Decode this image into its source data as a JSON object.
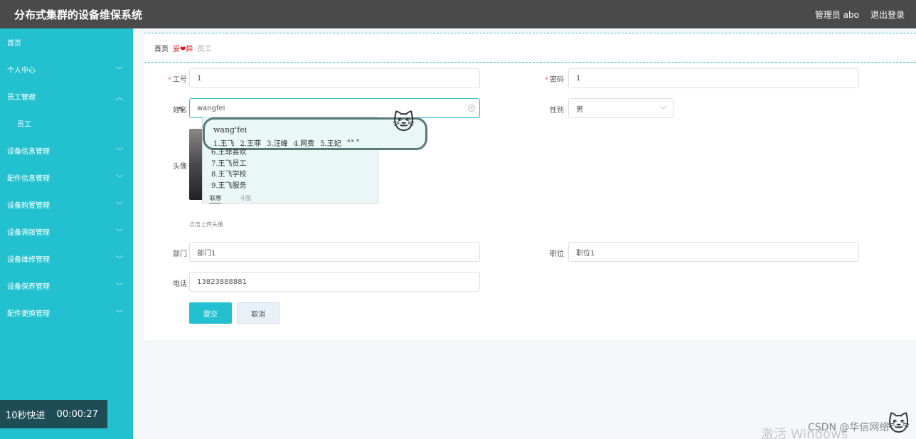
{
  "header": {
    "title": "分布式集群的设备维保系统",
    "user": "管理员 abo",
    "logout": "退出登录"
  },
  "sidebar": {
    "items": [
      {
        "label": "首页",
        "chevron": ""
      },
      {
        "label": "个人中心",
        "chevron": "﹀"
      },
      {
        "label": "员工管理",
        "chevron": "︿"
      },
      {
        "label": "员工",
        "chevron": ""
      },
      {
        "label": "设备信息管理",
        "chevron": "﹀"
      },
      {
        "label": "配件信息管理",
        "chevron": "﹀"
      },
      {
        "label": "设备购置管理",
        "chevron": "﹀"
      },
      {
        "label": "设备调拨管理",
        "chevron": "﹀"
      },
      {
        "label": "设备维修管理",
        "chevron": "﹀"
      },
      {
        "label": "设备保养管理",
        "chevron": "﹀"
      },
      {
        "label": "配件更换管理",
        "chevron": "﹀"
      }
    ]
  },
  "timer": {
    "label": "10秒快进",
    "time": "00:00:27"
  },
  "breadcrumb": {
    "home": "首页",
    "sep": "妥❤异",
    "current": "员工"
  },
  "form": {
    "job_no": {
      "label": "工号",
      "value": "1"
    },
    "password": {
      "label": "密码",
      "value": "1"
    },
    "name": {
      "label": "姓名",
      "value": "wangfei"
    },
    "gender": {
      "label": "性别",
      "value": "男"
    },
    "avatar": {
      "label": "头像",
      "hint": "点击上传头像"
    },
    "department": {
      "label": "部门",
      "value": "部门1"
    },
    "position": {
      "label": "职位",
      "value": "职位1"
    },
    "phone": {
      "label": "电话",
      "value": "13823888881"
    },
    "submit": "提交",
    "cancel": "取消"
  },
  "ime": {
    "pinyin": "wang'fei",
    "row1": [
      "1.王飞",
      "2.王菲",
      "3.汪峰",
      "4.网费",
      "5.王妃"
    ],
    "list": [
      "6.王菲喜欢",
      "7.王飞员工",
      "8.王飞学校",
      "9.王飞服务"
    ],
    "tab_active": "联想",
    "tab_other": "斗图",
    "nav": "◂ ▸ ▾"
  },
  "overlay": {
    "watermark": "激活 Windows",
    "csdn": "CSDN @华信网络"
  }
}
